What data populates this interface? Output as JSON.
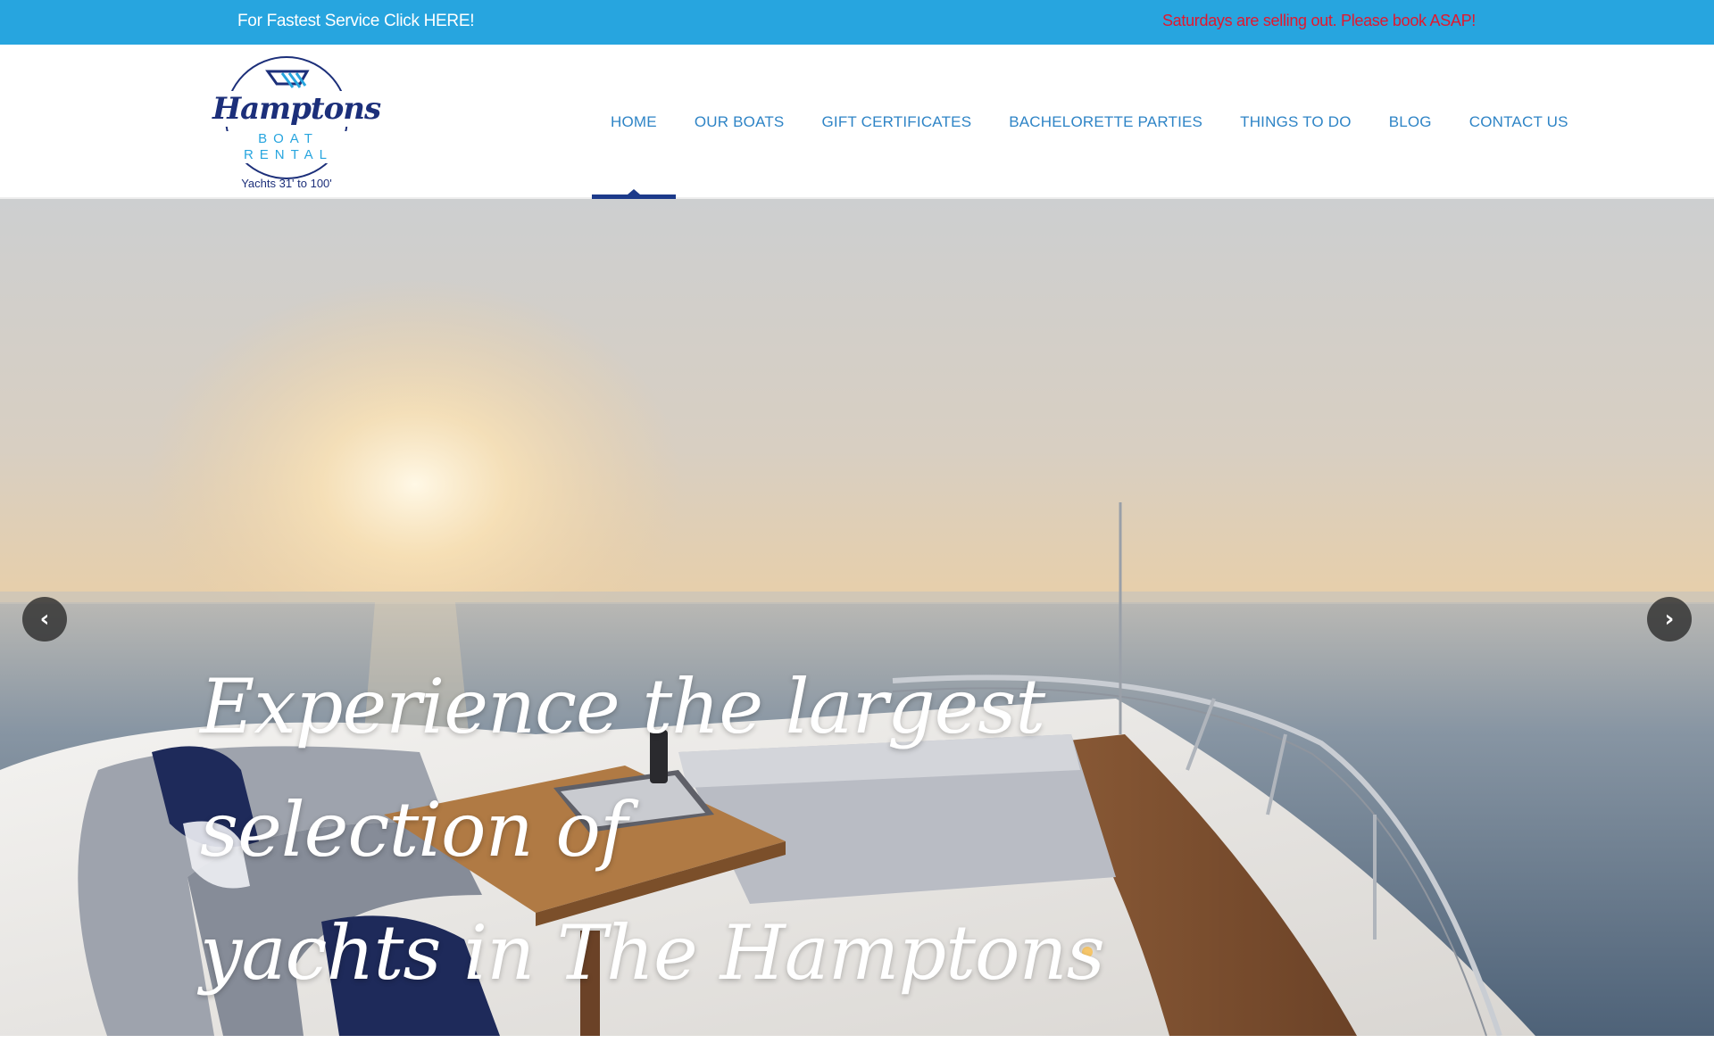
{
  "topbar": {
    "left_link": "For Fastest Service Click HERE!",
    "notice": "Saturdays are selling out. Please book ASAP!"
  },
  "logo": {
    "name": "Hamptons",
    "sub": "BOAT RENTAL",
    "tagline": "Yachts 31' to 100'"
  },
  "nav": {
    "items": [
      {
        "label": "HOME",
        "active": true
      },
      {
        "label": "OUR BOATS"
      },
      {
        "label": "GIFT CERTIFICATES"
      },
      {
        "label": "BACHELORETTE PARTIES"
      },
      {
        "label": "THINGS TO DO"
      },
      {
        "label": "BLOG"
      },
      {
        "label": "CONTACT US"
      }
    ]
  },
  "hero": {
    "title_line1": "Experience the largest selection of",
    "title_line2": "yachts in The Hamptons",
    "prev_icon": "chevron-left-icon",
    "next_icon": "chevron-right-icon"
  },
  "colors": {
    "topbar": "#27a5df",
    "notice": "#e3172e",
    "nav_text": "#2e84c6",
    "nav_active": "#1c3a8a",
    "logo_navy": "#1c2f7a"
  }
}
